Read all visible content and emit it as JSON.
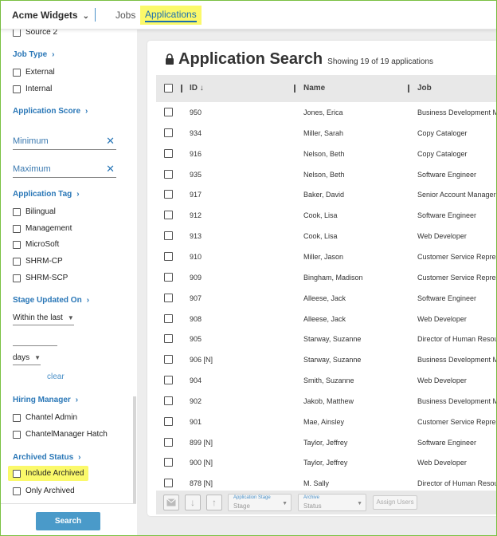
{
  "header": {
    "company": "Acme Widgets",
    "nav_jobs": "Jobs",
    "nav_applications": "Applications"
  },
  "sidebar": {
    "source2": "Source 2",
    "job_type": {
      "title": "Job Type",
      "options": [
        "External",
        "Internal"
      ]
    },
    "application_score": {
      "title": "Application Score",
      "min_placeholder": "Minimum",
      "max_placeholder": "Maximum"
    },
    "application_tag": {
      "title": "Application Tag",
      "options": [
        "Bilingual",
        "Management",
        "MicroSoft",
        "SHRM-CP",
        "SHRM-SCP"
      ]
    },
    "stage_updated": {
      "title": "Stage Updated On",
      "within": "Within the last",
      "unit": "days",
      "clear": "clear"
    },
    "hiring_manager": {
      "title": "Hiring Manager",
      "options": [
        "Chantel Admin",
        "ChantelManager Hatch"
      ]
    },
    "archived_status": {
      "title": "Archived Status",
      "options": [
        "Include Archived",
        "Only Archived"
      ]
    },
    "search_button": "Search"
  },
  "main": {
    "title": "Application Search",
    "count_text": "Showing 19 of 19 applications",
    "columns": {
      "id": "ID",
      "name": "Name",
      "job": "Job"
    },
    "rows": [
      {
        "id": "950",
        "name": "Jones, Erica",
        "job": "Business Development M"
      },
      {
        "id": "934",
        "name": "Miller, Sarah",
        "job": "Copy Cataloger"
      },
      {
        "id": "916",
        "name": "Nelson, Beth",
        "job": "Copy Cataloger"
      },
      {
        "id": "935",
        "name": "Nelson, Beth",
        "job": "Software Engineer"
      },
      {
        "id": "917",
        "name": "Baker, David",
        "job": "Senior Account Manager"
      },
      {
        "id": "912",
        "name": "Cook, Lisa",
        "job": "Software Engineer"
      },
      {
        "id": "913",
        "name": "Cook, Lisa",
        "job": "Web Developer"
      },
      {
        "id": "910",
        "name": "Miller, Jason",
        "job": "Customer Service Repres"
      },
      {
        "id": "909",
        "name": "Bingham, Madison",
        "job": "Customer Service Repres"
      },
      {
        "id": "907",
        "name": "Alleese, Jack",
        "job": "Software Engineer"
      },
      {
        "id": "908",
        "name": "Alleese, Jack",
        "job": "Web Developer"
      },
      {
        "id": "905",
        "name": "Starway, Suzanne",
        "job": "Director of Human Resou"
      },
      {
        "id": "906 [N]",
        "name": "Starway, Suzanne",
        "job": "Business Development M"
      },
      {
        "id": "904",
        "name": "Smith, Suzanne",
        "job": "Web Developer"
      },
      {
        "id": "902",
        "name": "Jakob, Matthew",
        "job": "Business Development M"
      },
      {
        "id": "901",
        "name": "Mae, Ainsley",
        "job": "Customer Service Repres"
      },
      {
        "id": "899 [N]",
        "name": "Taylor, Jeffrey",
        "job": "Software Engineer"
      },
      {
        "id": "900 [N]",
        "name": "Taylor, Jeffrey",
        "job": "Web Developer"
      },
      {
        "id": "878 [N]",
        "name": "M. Sally",
        "job": "Director of Human Resou"
      }
    ],
    "toolbar": {
      "stage_label": "Application Stage",
      "stage_value": "Stage",
      "archive_label": "Archive",
      "archive_value": "Status",
      "assign_users": "Assign Users"
    }
  },
  "colors": {
    "accent": "#2a77b7",
    "highlight": "#fbf96a",
    "search_button": "#4a9ac9",
    "frame": "#7ac142"
  }
}
